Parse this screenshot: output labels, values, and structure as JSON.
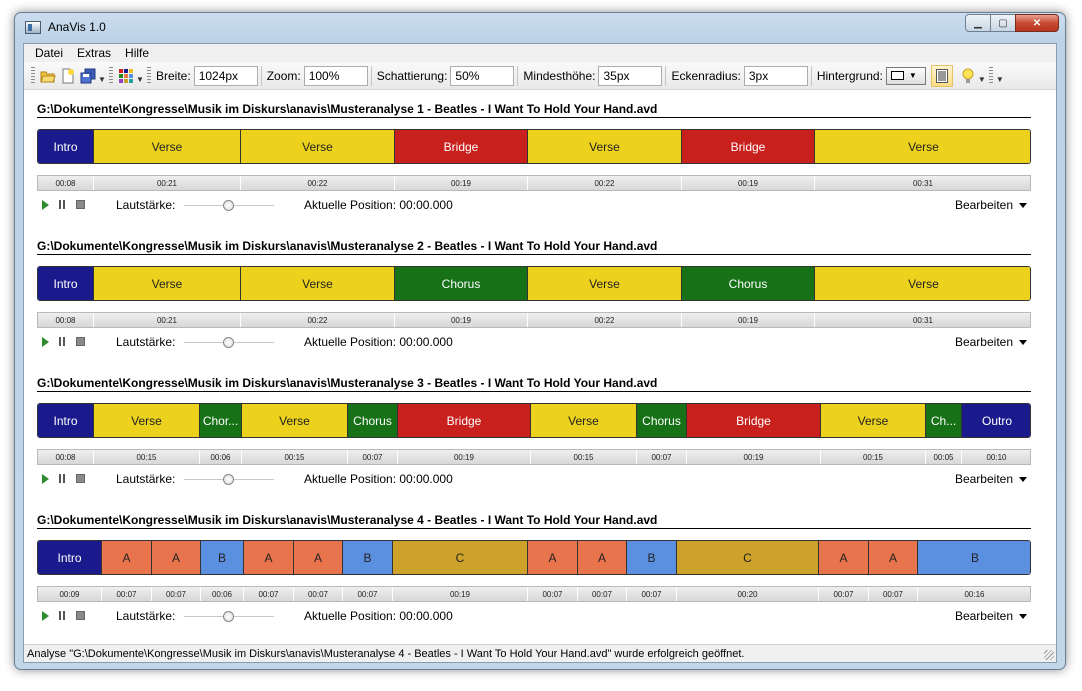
{
  "window": {
    "title": "AnaVis 1.0"
  },
  "menu": [
    "Datei",
    "Extras",
    "Hilfe"
  ],
  "toolbar": {
    "breite_label": "Breite:",
    "breite": "1024px",
    "zoom_label": "Zoom:",
    "zoom": "100%",
    "schattierung_label": "Schattierung:",
    "schattierung": "50%",
    "mindesthoehe_label": "Mindesthöhe:",
    "mindesthoehe": "35px",
    "eckenradius_label": "Eckenradius:",
    "eckenradius": "3px",
    "hintergrund_label": "Hintergrund:"
  },
  "colors": {
    "intro": "#1a1a8c",
    "verse": "#ecd21c",
    "bridge": "#c8201c",
    "chorus": "#177117",
    "a": "#e7744c",
    "b": "#5b8fe0",
    "c": "#cca22a"
  },
  "controls": {
    "volume_label": "Lautstärke:",
    "position_label": "Aktuelle Position: 00:00.000",
    "edit_label": "Bearbeiten"
  },
  "analyses": [
    {
      "title": "G:\\Dokumente\\Kongresse\\Musik im Diskurs\\anavis\\Musteranalyse 1 - Beatles - I Want To Hold Your Hand.avd",
      "segments": [
        {
          "label": "Intro",
          "type": "intro",
          "duration": "00:08"
        },
        {
          "label": "Verse",
          "type": "verse",
          "duration": "00:21"
        },
        {
          "label": "Verse",
          "type": "verse",
          "duration": "00:22"
        },
        {
          "label": "Bridge",
          "type": "bridge",
          "duration": "00:19"
        },
        {
          "label": "Verse",
          "type": "verse",
          "duration": "00:22"
        },
        {
          "label": "Bridge",
          "type": "bridge",
          "duration": "00:19"
        },
        {
          "label": "Verse",
          "type": "verse",
          "duration": "00:31"
        }
      ]
    },
    {
      "title": "G:\\Dokumente\\Kongresse\\Musik im Diskurs\\anavis\\Musteranalyse 2 - Beatles - I Want To Hold Your Hand.avd",
      "segments": [
        {
          "label": "Intro",
          "type": "intro",
          "duration": "00:08"
        },
        {
          "label": "Verse",
          "type": "verse",
          "duration": "00:21"
        },
        {
          "label": "Verse",
          "type": "verse",
          "duration": "00:22"
        },
        {
          "label": "Chorus",
          "type": "chorus",
          "duration": "00:19"
        },
        {
          "label": "Verse",
          "type": "verse",
          "duration": "00:22"
        },
        {
          "label": "Chorus",
          "type": "chorus",
          "duration": "00:19"
        },
        {
          "label": "Verse",
          "type": "verse",
          "duration": "00:31"
        }
      ]
    },
    {
      "title": "G:\\Dokumente\\Kongresse\\Musik im Diskurs\\anavis\\Musteranalyse 3 - Beatles - I Want To Hold Your Hand.avd",
      "segments": [
        {
          "label": "Intro",
          "type": "intro",
          "duration": "00:08"
        },
        {
          "label": "Verse",
          "type": "verse",
          "duration": "00:15"
        },
        {
          "label": "Chor...",
          "type": "chorus",
          "duration": "00:06"
        },
        {
          "label": "Verse",
          "type": "verse",
          "duration": "00:15"
        },
        {
          "label": "Chorus",
          "type": "chorus",
          "duration": "00:07"
        },
        {
          "label": "Bridge",
          "type": "bridge",
          "duration": "00:19"
        },
        {
          "label": "Verse",
          "type": "verse",
          "duration": "00:15"
        },
        {
          "label": "Chorus",
          "type": "chorus",
          "duration": "00:07"
        },
        {
          "label": "Bridge",
          "type": "bridge",
          "duration": "00:19"
        },
        {
          "label": "Verse",
          "type": "verse",
          "duration": "00:15"
        },
        {
          "label": "Ch...",
          "type": "chorus",
          "duration": "00:05"
        },
        {
          "label": "Outro",
          "type": "intro",
          "duration": "00:10"
        }
      ]
    },
    {
      "title": "G:\\Dokumente\\Kongresse\\Musik im Diskurs\\anavis\\Musteranalyse 4 - Beatles - I Want To Hold Your Hand.avd",
      "segments": [
        {
          "label": "Intro",
          "type": "intro",
          "duration": "00:09"
        },
        {
          "label": "A",
          "type": "a",
          "duration": "00:07"
        },
        {
          "label": "A",
          "type": "a",
          "duration": "00:07"
        },
        {
          "label": "B",
          "type": "b",
          "duration": "00:06"
        },
        {
          "label": "A",
          "type": "a",
          "duration": "00:07"
        },
        {
          "label": "A",
          "type": "a",
          "duration": "00:07"
        },
        {
          "label": "B",
          "type": "b",
          "duration": "00:07"
        },
        {
          "label": "C",
          "type": "c",
          "duration": "00:19"
        },
        {
          "label": "A",
          "type": "a",
          "duration": "00:07"
        },
        {
          "label": "A",
          "type": "a",
          "duration": "00:07"
        },
        {
          "label": "B",
          "type": "b",
          "duration": "00:07"
        },
        {
          "label": "C",
          "type": "c",
          "duration": "00:20"
        },
        {
          "label": "A",
          "type": "a",
          "duration": "00:07"
        },
        {
          "label": "A",
          "type": "a",
          "duration": "00:07"
        },
        {
          "label": "B",
          "type": "b",
          "duration": "00:16"
        }
      ]
    }
  ],
  "status": "Analyse \"G:\\Dokumente\\Kongresse\\Musik im Diskurs\\anavis\\Musteranalyse 4 - Beatles - I Want To Hold Your Hand.avd\" wurde erfolgreich geöffnet."
}
